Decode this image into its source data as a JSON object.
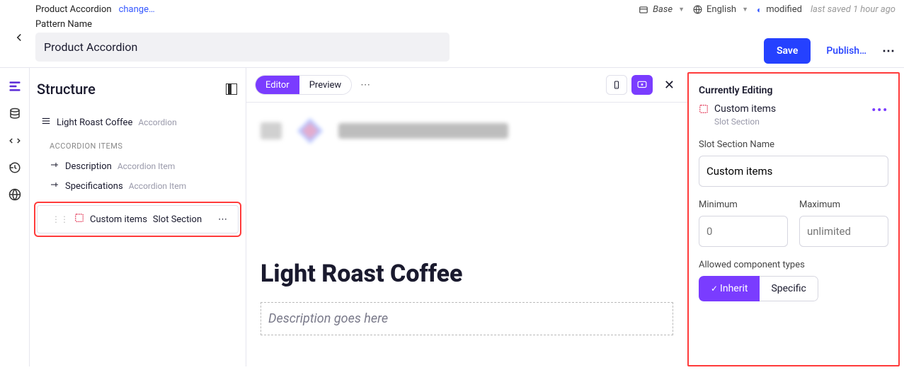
{
  "breadcrumb": {
    "name": "Product Accordion",
    "change": "change…"
  },
  "pattern": {
    "label": "Pattern Name",
    "value": "Product Accordion"
  },
  "topMeta": {
    "variant": "Base",
    "locale": "English",
    "status": "modified",
    "saved": "last saved 1 hour ago"
  },
  "actions": {
    "save": "Save",
    "publish": "Publish…"
  },
  "structure": {
    "title": "Structure",
    "root": {
      "name": "Light Roast Coffee",
      "type": "Accordion"
    },
    "sectionLabel": "ACCORDION ITEMS",
    "items": [
      {
        "name": "Description",
        "type": "Accordion Item"
      },
      {
        "name": "Specifications",
        "type": "Accordion Item"
      }
    ],
    "selected": {
      "name": "Custom items",
      "type": "Slot Section"
    }
  },
  "canvas": {
    "editor": "Editor",
    "preview": "Preview",
    "title": "Light Roast Coffee",
    "descPlaceholder": "Description goes here"
  },
  "inspector": {
    "heading": "Currently Editing",
    "name": "Custom items",
    "type": "Slot Section",
    "slotNameLabel": "Slot Section Name",
    "slotNameValue": "Custom items",
    "minLabel": "Minimum",
    "minPlaceholder": "0",
    "maxLabel": "Maximum",
    "maxPlaceholder": "unlimited",
    "allowedLabel": "Allowed component types",
    "inherit": "Inherit",
    "specific": "Specific"
  }
}
